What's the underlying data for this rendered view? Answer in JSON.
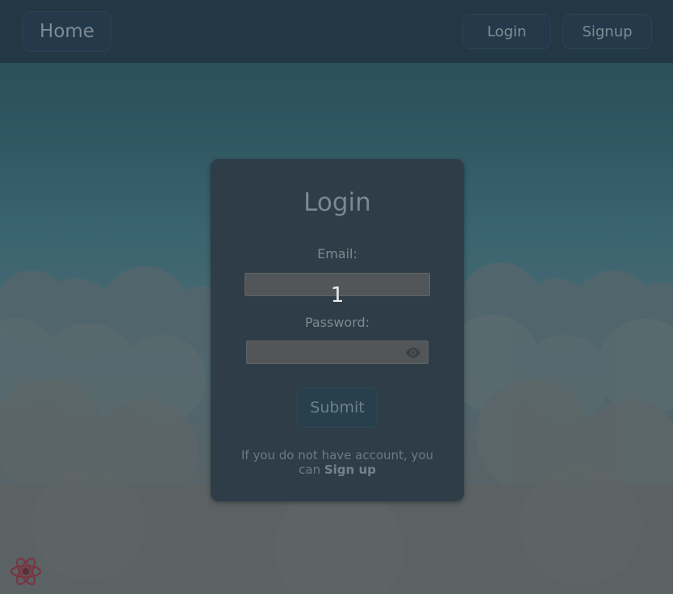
{
  "navbar": {
    "home_label": "Home",
    "login_label": "Login",
    "signup_label": "Signup"
  },
  "form": {
    "title": "Login",
    "email_label": "Email:",
    "email_value": "",
    "password_label": "Password:",
    "password_value": "",
    "password_toggle_icon": "eye-icon",
    "submit_label": "Submit",
    "footnote_prefix": "If you do not have account, you can",
    "footnote_link": "Sign up"
  },
  "overlay": {
    "counter": "1"
  },
  "corner_logo": {
    "icon": "react-atom-icon"
  },
  "colors": {
    "navbar_bg": "#223845",
    "card_bg": "#2f3d48",
    "input_bg": "#525658",
    "submit_bg": "#28404c",
    "logo": "#8a3a44"
  }
}
